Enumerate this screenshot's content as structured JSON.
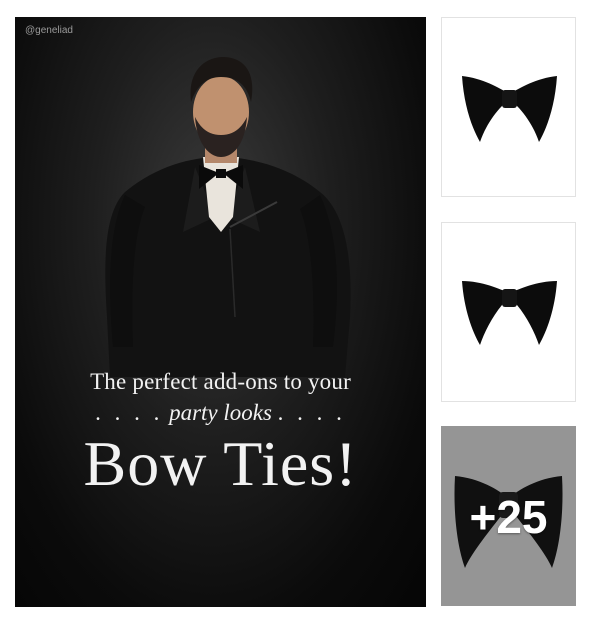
{
  "hero": {
    "handle": "@geneliad",
    "caption_line1": "The perfect add-ons to your",
    "caption_line2_dots_left": ". . . .",
    "caption_line2_italic": "party looks",
    "caption_line2_dots_right": ". . . .",
    "caption_title": "Bow Ties!"
  },
  "thumbnails": {
    "more_count": "+25"
  }
}
